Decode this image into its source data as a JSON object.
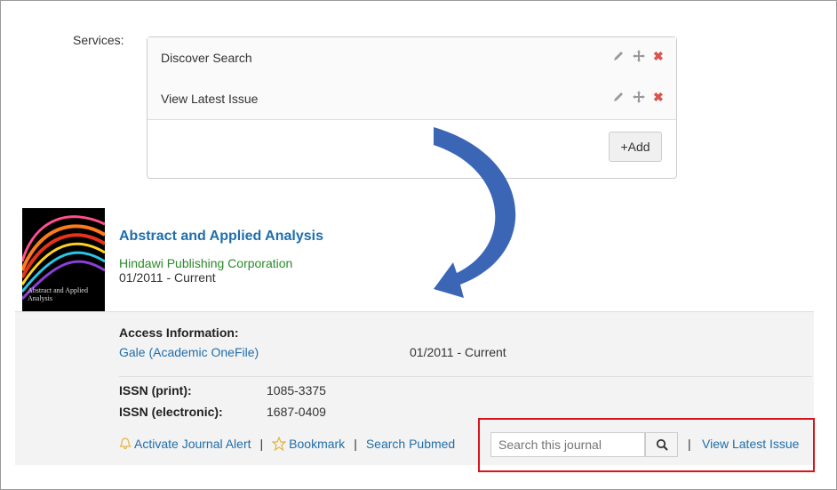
{
  "services": {
    "label": "Services:",
    "items": [
      {
        "label": "Discover Search"
      },
      {
        "label": "View Latest Issue"
      }
    ],
    "add_label": "+Add"
  },
  "journal": {
    "title": "Abstract and Applied Analysis",
    "publisher": "Hindawi Publishing Corporation",
    "coverage": "01/2011 - Current",
    "cover_text": "Abstract and Applied Analysis"
  },
  "access": {
    "heading": "Access Information:",
    "provider": "Gale (Academic OneFile)",
    "range": "01/2011 - Current"
  },
  "issn": {
    "print_label": "ISSN (print):",
    "print_value": "1085-3375",
    "electronic_label": "ISSN (electronic):",
    "electronic_value": "1687-0409"
  },
  "actions": {
    "alert": "Activate Journal Alert",
    "bookmark": "Bookmark",
    "pubmed": "Search Pubmed",
    "search_placeholder": "Search this journal",
    "latest": "View Latest Issue"
  },
  "colors": {
    "link": "#1f6eab",
    "publisher": "#2a8a2a",
    "highlight_box": "#d9141b",
    "arrow": "#3b66b5"
  }
}
